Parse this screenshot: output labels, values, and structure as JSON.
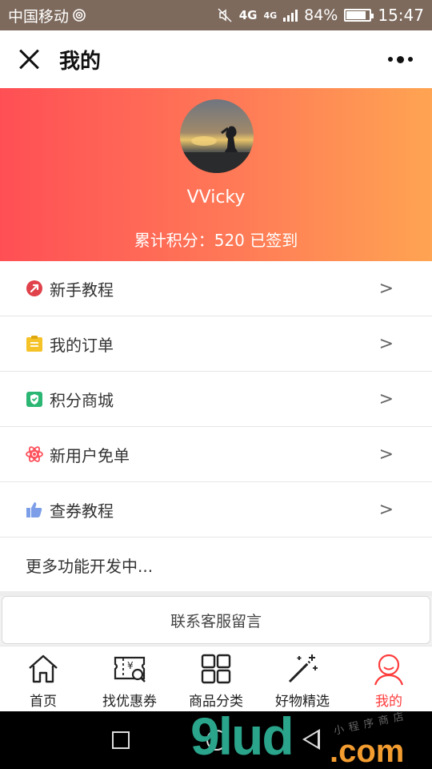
{
  "status_bar": {
    "carrier": "中国移动",
    "network": "4G",
    "network2": "4G",
    "battery": "84%",
    "battery_level": 0.84,
    "time": "15:47"
  },
  "header": {
    "title": "我的"
  },
  "profile": {
    "username": "VVicky",
    "points_text": "累计积分：520  已签到"
  },
  "menu": {
    "items": [
      {
        "label": "新手教程",
        "arrow": ">",
        "icon": "tutorial-icon",
        "color": "#e0414a"
      },
      {
        "label": "我的订单",
        "arrow": ">",
        "icon": "order-icon",
        "color": "#f5c228"
      },
      {
        "label": "积分商城",
        "arrow": ">",
        "icon": "shield-check-icon",
        "color": "#2bb673"
      },
      {
        "label": "新用户免单",
        "arrow": ">",
        "icon": "atom-icon",
        "color": "#ff4f5a"
      },
      {
        "label": "查券教程",
        "arrow": ">",
        "icon": "thumbs-up-icon",
        "color": "#7c9ee8"
      }
    ],
    "more_label": "更多功能开发中..."
  },
  "contact": {
    "label": "联系客服留言"
  },
  "tabbar": {
    "tabs": [
      {
        "label": "首页",
        "icon": "home-icon"
      },
      {
        "label": "找优惠券",
        "icon": "coupon-search-icon"
      },
      {
        "label": "商品分类",
        "icon": "grid-icon"
      },
      {
        "label": "好物精选",
        "icon": "magic-wand-icon"
      },
      {
        "label": "我的",
        "icon": "user-icon",
        "active": true
      }
    ],
    "active_color": "#ff3b3b"
  },
  "watermark": {
    "main": "9lud",
    "suffix": ".com",
    "small": "小程序商店"
  }
}
